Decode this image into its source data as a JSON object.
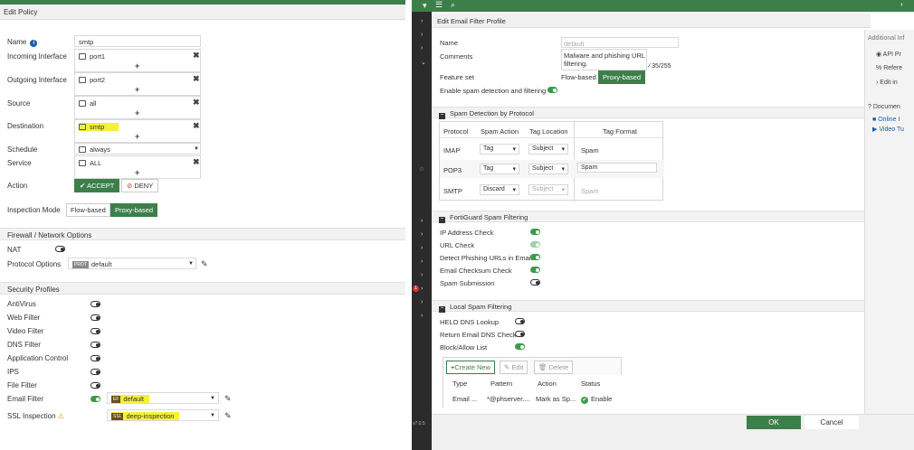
{
  "policy": {
    "header": "Edit Policy",
    "name_label": "Name",
    "name_value": "smtp",
    "incoming_label": "Incoming Interface",
    "incoming_value": "port1",
    "outgoing_label": "Outgoing Interface",
    "outgoing_value": "port2",
    "source_label": "Source",
    "source_value": "all",
    "destination_label": "Destination",
    "destination_value": "smtp",
    "schedule_label": "Schedule",
    "schedule_value": "always",
    "service_label": "Service",
    "service_value": "ALL",
    "action_label": "Action",
    "accept_label": "ACCEPT",
    "deny_label": "DENY",
    "inspection_label": "Inspection Mode",
    "flow_label": "Flow-based",
    "proxy_label": "Proxy-based",
    "fw_section": "Firewall / Network Options",
    "nat_label": "NAT",
    "protocol_options_label": "Protocol Options",
    "protocol_badge": "PROT",
    "protocol_value": "default",
    "sec_section": "Security Profiles",
    "profiles": [
      {
        "label": "AntiVirus",
        "state": "off"
      },
      {
        "label": "Web Filter",
        "state": "off"
      },
      {
        "label": "Video Filter",
        "state": "off"
      },
      {
        "label": "DNS Filter",
        "state": "off"
      },
      {
        "label": "Application Control",
        "state": "off"
      },
      {
        "label": "IPS",
        "state": "off"
      },
      {
        "label": "File Filter",
        "state": "off"
      }
    ],
    "email_filter_label": "Email Filter",
    "email_badge": "EF",
    "email_value": "default",
    "ssl_label": "SSL Inspection",
    "ssl_badge": "SSL",
    "ssl_value": "deep-inspection"
  },
  "profile": {
    "header": "Edit Email Filter Profile",
    "name_label": "Name",
    "name_value": "default",
    "comments_label": "Comments",
    "comments_value_1": "Malware and phishing URL",
    "comments_value_2": "filtering.",
    "comments_count": "35/255",
    "feature_label": "Feature set",
    "flow_label": "Flow-based",
    "proxy_label": "Proxy-based",
    "enable_spam_label": "Enable spam detection and filtering",
    "spam_protocol_section": "Spam Detection by Protocol",
    "table_headers": [
      "Protocol",
      "Spam Action",
      "Tag Location",
      "Tag Format"
    ],
    "protocol_rows": [
      {
        "protocol": "IMAP",
        "action": "Tag",
        "location": "Subject",
        "format": "Spam",
        "dim": false
      },
      {
        "protocol": "POP3",
        "action": "Tag",
        "location": "Subject",
        "format": "Spam",
        "dim": false
      },
      {
        "protocol": "SMTP",
        "action": "Discard",
        "location": "Subject",
        "format": "Spam",
        "dim": true
      }
    ],
    "fortiguard_section": "FortiGuard Spam Filtering",
    "fortiguard_items": [
      {
        "label": "IP Address Check",
        "state": "on"
      },
      {
        "label": "URL Check",
        "state": "onlight"
      },
      {
        "label": "Detect Phishing URLs in Email",
        "state": "on"
      },
      {
        "label": "Email Checksum Check",
        "state": "on"
      },
      {
        "label": "Spam Submission",
        "state": "off"
      }
    ],
    "local_section": "Local Spam Filtering",
    "local_items": [
      {
        "label": "HELO DNS Lookup",
        "state": "off"
      },
      {
        "label": "Return Email DNS Check",
        "state": "off"
      },
      {
        "label": "Block/Allow List",
        "state": "on"
      }
    ],
    "create_new": "Create New",
    "edit": "Edit",
    "delete": "Delete",
    "list_headers": [
      "Type",
      "Pattern",
      "Action",
      "Status"
    ],
    "list_row": {
      "type": "Email ...",
      "pattern": "*@phserver....",
      "action": "Mark as Sp...",
      "status": "Enable"
    },
    "ok": "OK",
    "cancel": "Cancel"
  },
  "right_panel": {
    "additional": "Additional Inf",
    "api": "API Pr",
    "refer": "Refere",
    "edit_in": "Edit in",
    "documents": "Documen",
    "online": "Online I",
    "video": "Video Tu"
  },
  "nav": {
    "version": "v7.0.5",
    "notif": "1"
  },
  "colors": {
    "brand_green": "#3d7f4a",
    "toggle_green": "#3d9a4b",
    "highlight": "#f6f03a",
    "sidenav": "#2b2b2b"
  }
}
